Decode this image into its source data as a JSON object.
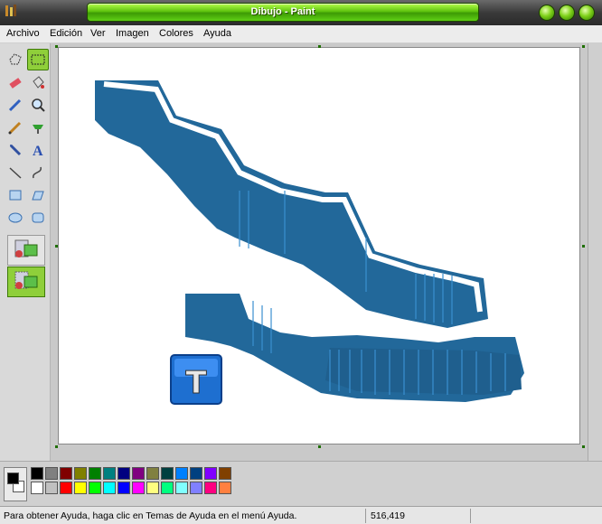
{
  "window": {
    "title": "Dibujo - Paint"
  },
  "menu": {
    "items": [
      "Archivo",
      "Edición",
      "Ver",
      "Imagen",
      "Colores",
      "Ayuda"
    ]
  },
  "tools": [
    "free-select",
    "rect-select",
    "eraser",
    "fill",
    "color-picker",
    "magnifier",
    "pencil",
    "brush",
    "airbrush",
    "text",
    "line",
    "curve",
    "rectangle",
    "polygon",
    "ellipse",
    "rounded-rectangle"
  ],
  "palette": {
    "top_row": [
      "#000000",
      "#808080",
      "#800000",
      "#808000",
      "#008000",
      "#008080",
      "#000080",
      "#800080",
      "#808040",
      "#004040",
      "#0080ff",
      "#004080",
      "#8000ff",
      "#804000"
    ],
    "bottom_row": [
      "#ffffff",
      "#c0c0c0",
      "#ff0000",
      "#ffff00",
      "#00ff00",
      "#00ffff",
      "#0000ff",
      "#ff00ff",
      "#ffff80",
      "#00ff80",
      "#80ffff",
      "#8080ff",
      "#ff0080",
      "#ff8040"
    ],
    "foreground": "#000000",
    "background": "#ffffff"
  },
  "status": {
    "help_text": "Para obtener Ayuda, haga clic en Temas de Ayuda en el menú Ayuda.",
    "coords": "516,419"
  },
  "canvas": {
    "logo_letter": "T"
  },
  "colors": {
    "accent": "#5fc40e",
    "shape_blue": "#22689a"
  }
}
